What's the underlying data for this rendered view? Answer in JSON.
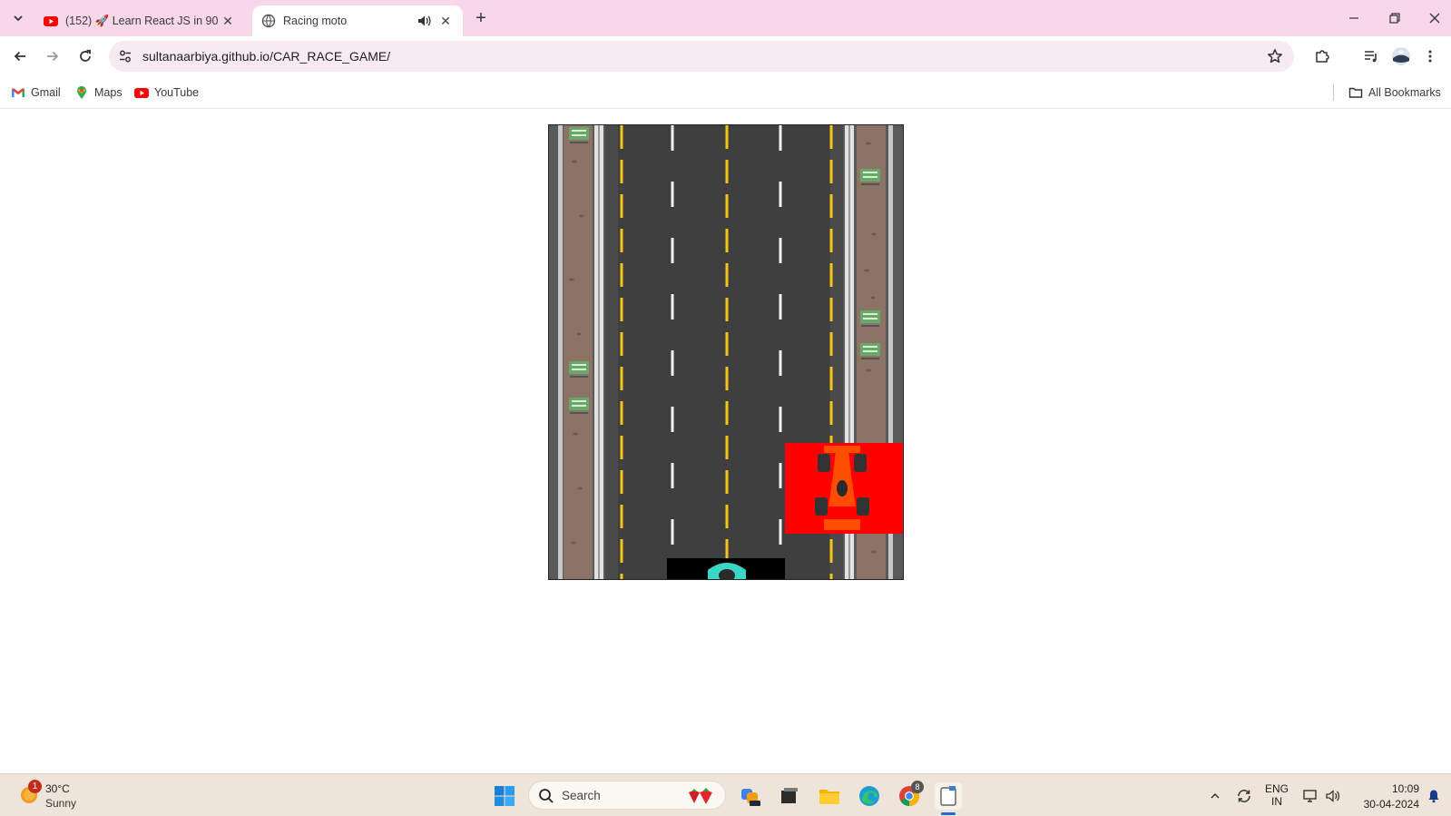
{
  "browser": {
    "tabs": [
      {
        "title": "(152) 🚀 Learn React JS in 90 Minutes",
        "favicon": "youtube-icon",
        "active": false
      },
      {
        "title": "Racing moto",
        "favicon": "globe-icon",
        "active": true,
        "audio": "speaker-icon"
      }
    ],
    "address": {
      "url": "sultanaarbiya.github.io/CAR_RACE_GAME/"
    },
    "bookmarks": [
      {
        "label": "Gmail",
        "icon": "gmail-icon"
      },
      {
        "label": "Maps",
        "icon": "maps-icon"
      },
      {
        "label": "YouTube",
        "icon": "youtube-icon"
      }
    ],
    "all_bookmarks_label": "All Bookmarks"
  },
  "game": {
    "road_color": "#444444",
    "lane_yellow": "#f5c518",
    "enemy_car_bg": "#ff0000",
    "enemy_car_color": "#ff4d00",
    "player_car_color": "#3ad6c6"
  },
  "taskbar": {
    "weather": {
      "temp": "30°C",
      "condition": "Sunny",
      "badge": "1"
    },
    "search_placeholder": "Search",
    "chrome_badge": "8",
    "language": {
      "line1": "ENG",
      "line2": "IN"
    },
    "clock": {
      "time": "10:09",
      "date": "30-04-2024"
    }
  },
  "colors": {
    "tabstrip": "#f7d7e9",
    "omnibox": "#f7eaf1",
    "taskbar": "#efe4d9"
  }
}
